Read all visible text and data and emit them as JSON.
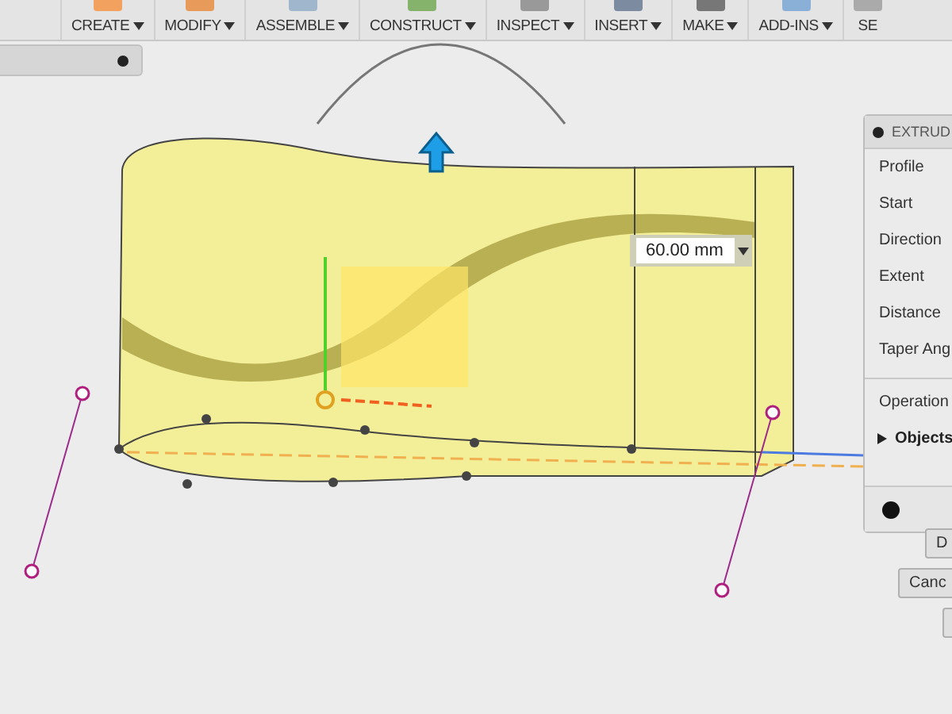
{
  "toolbar": {
    "groups": [
      {
        "label": "CREATE",
        "dropdown": true
      },
      {
        "label": "MODIFY",
        "dropdown": true
      },
      {
        "label": "ASSEMBLE",
        "dropdown": true
      },
      {
        "label": "CONSTRUCT",
        "dropdown": true
      },
      {
        "label": "INSPECT",
        "dropdown": true
      },
      {
        "label": "INSERT",
        "dropdown": true
      },
      {
        "label": "MAKE",
        "dropdown": true
      },
      {
        "label": "ADD-INS",
        "dropdown": true
      },
      {
        "label": "SE",
        "dropdown": false
      }
    ]
  },
  "dimension": {
    "value": "60.00 mm"
  },
  "extrude_panel": {
    "title": "EXTRUD",
    "rows": [
      {
        "label": "Profile"
      },
      {
        "label": "Start"
      },
      {
        "label": "Direction"
      },
      {
        "label": "Extent"
      },
      {
        "label": "Distance"
      },
      {
        "label": "Taper Ang"
      }
    ],
    "more_rows": [
      {
        "label": "Operation"
      }
    ],
    "section": {
      "label": "Objects",
      "expanded": false
    }
  },
  "buttons": [
    {
      "label": "D"
    },
    {
      "label": "Canc"
    }
  ]
}
